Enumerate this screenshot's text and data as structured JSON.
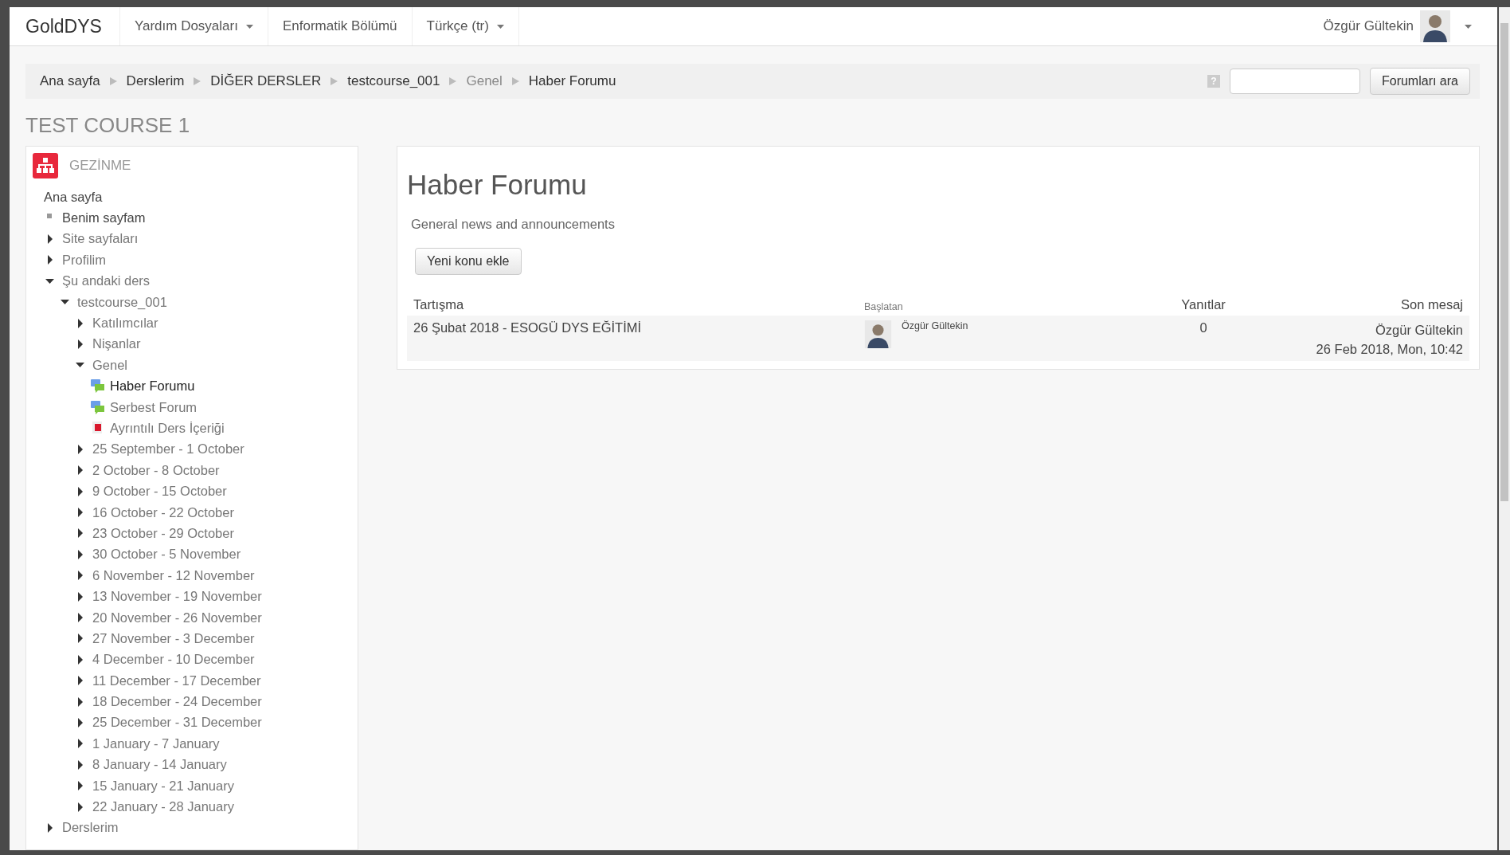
{
  "navbar": {
    "brand": "GoldDYS",
    "menus": [
      {
        "label": "Yardım Dosyaları",
        "dropdown": true
      },
      {
        "label": "Enformatik Bölümü",
        "dropdown": false
      },
      {
        "label": "Türkçe (tr)",
        "dropdown": true
      }
    ],
    "user": "Özgür Gültekin"
  },
  "breadcrumb": [
    {
      "label": "Ana sayfa",
      "link": true
    },
    {
      "label": "Derslerim",
      "link": true
    },
    {
      "label": "DİĞER DERSLER",
      "link": true
    },
    {
      "label": "testcourse_001",
      "link": true
    },
    {
      "label": "Genel",
      "link": false
    },
    {
      "label": "Haber Forumu",
      "link": true
    }
  ],
  "search": {
    "help": "?",
    "button": "Forumları ara"
  },
  "course_title": "TEST COURSE 1",
  "nav": {
    "title": "GEZİNME",
    "items": [
      {
        "label": "Ana sayfa",
        "kind": "root",
        "active": false,
        "children": [
          {
            "label": "Benim sayfam",
            "kind": "leaf",
            "active": false
          },
          {
            "label": "Site sayfaları",
            "kind": "branch",
            "expanded": false,
            "active": false
          },
          {
            "label": "Profilim",
            "kind": "branch",
            "expanded": false,
            "active": false
          },
          {
            "label": "Şu andaki ders",
            "kind": "branch",
            "expanded": true,
            "active": false,
            "children": [
              {
                "label": "testcourse_001",
                "kind": "branch",
                "expanded": true,
                "active": false,
                "children": [
                  {
                    "label": "Katılımcılar",
                    "kind": "branch",
                    "expanded": false,
                    "active": false
                  },
                  {
                    "label": "Nişanlar",
                    "kind": "branch",
                    "expanded": false,
                    "active": false
                  },
                  {
                    "label": "Genel",
                    "kind": "branch",
                    "expanded": true,
                    "active": false,
                    "children": [
                      {
                        "label": "Haber Forumu",
                        "kind": "forum",
                        "active": true
                      },
                      {
                        "label": "Serbest Forum",
                        "kind": "forum",
                        "active": false
                      },
                      {
                        "label": "Ayrıntılı Ders İçeriği",
                        "kind": "pdf",
                        "active": false
                      }
                    ]
                  },
                  {
                    "label": "25 September - 1 October",
                    "kind": "branch",
                    "expanded": false,
                    "active": false
                  },
                  {
                    "label": "2 October - 8 October",
                    "kind": "branch",
                    "expanded": false,
                    "active": false
                  },
                  {
                    "label": "9 October - 15 October",
                    "kind": "branch",
                    "expanded": false,
                    "active": false
                  },
                  {
                    "label": "16 October - 22 October",
                    "kind": "branch",
                    "expanded": false,
                    "active": false
                  },
                  {
                    "label": "23 October - 29 October",
                    "kind": "branch",
                    "expanded": false,
                    "active": false
                  },
                  {
                    "label": "30 October - 5 November",
                    "kind": "branch",
                    "expanded": false,
                    "active": false
                  },
                  {
                    "label": "6 November - 12 November",
                    "kind": "branch",
                    "expanded": false,
                    "active": false
                  },
                  {
                    "label": "13 November - 19 November",
                    "kind": "branch",
                    "expanded": false,
                    "active": false
                  },
                  {
                    "label": "20 November - 26 November",
                    "kind": "branch",
                    "expanded": false,
                    "active": false
                  },
                  {
                    "label": "27 November - 3 December",
                    "kind": "branch",
                    "expanded": false,
                    "active": false
                  },
                  {
                    "label": "4 December - 10 December",
                    "kind": "branch",
                    "expanded": false,
                    "active": false
                  },
                  {
                    "label": "11 December - 17 December",
                    "kind": "branch",
                    "expanded": false,
                    "active": false
                  },
                  {
                    "label": "18 December - 24 December",
                    "kind": "branch",
                    "expanded": false,
                    "active": false
                  },
                  {
                    "label": "25 December - 31 December",
                    "kind": "branch",
                    "expanded": false,
                    "active": false
                  },
                  {
                    "label": "1 January - 7 January",
                    "kind": "branch",
                    "expanded": false,
                    "active": false
                  },
                  {
                    "label": "8 January - 14 January",
                    "kind": "branch",
                    "expanded": false,
                    "active": false
                  },
                  {
                    "label": "15 January - 21 January",
                    "kind": "branch",
                    "expanded": false,
                    "active": false
                  },
                  {
                    "label": "22 January - 28 January",
                    "kind": "branch",
                    "expanded": false,
                    "active": false
                  }
                ]
              }
            ]
          },
          {
            "label": "Derslerim",
            "kind": "branch",
            "expanded": false,
            "active": false
          }
        ]
      }
    ]
  },
  "forum": {
    "title": "Haber Forumu",
    "description": "General news and announcements",
    "add_button": "Yeni konu ekle",
    "columns": [
      "Tartışma",
      "Başlatan",
      "Yanıtlar",
      "Son mesaj"
    ],
    "rows": [
      {
        "discussion": "26 Şubat 2018 - ESOGÜ DYS EĞİTİMİ",
        "starter": "Özgür Gültekin",
        "replies": "0",
        "last_user": "Özgür Gültekin",
        "last_date": "26 Feb 2018, Mon, 10:42"
      }
    ]
  }
}
